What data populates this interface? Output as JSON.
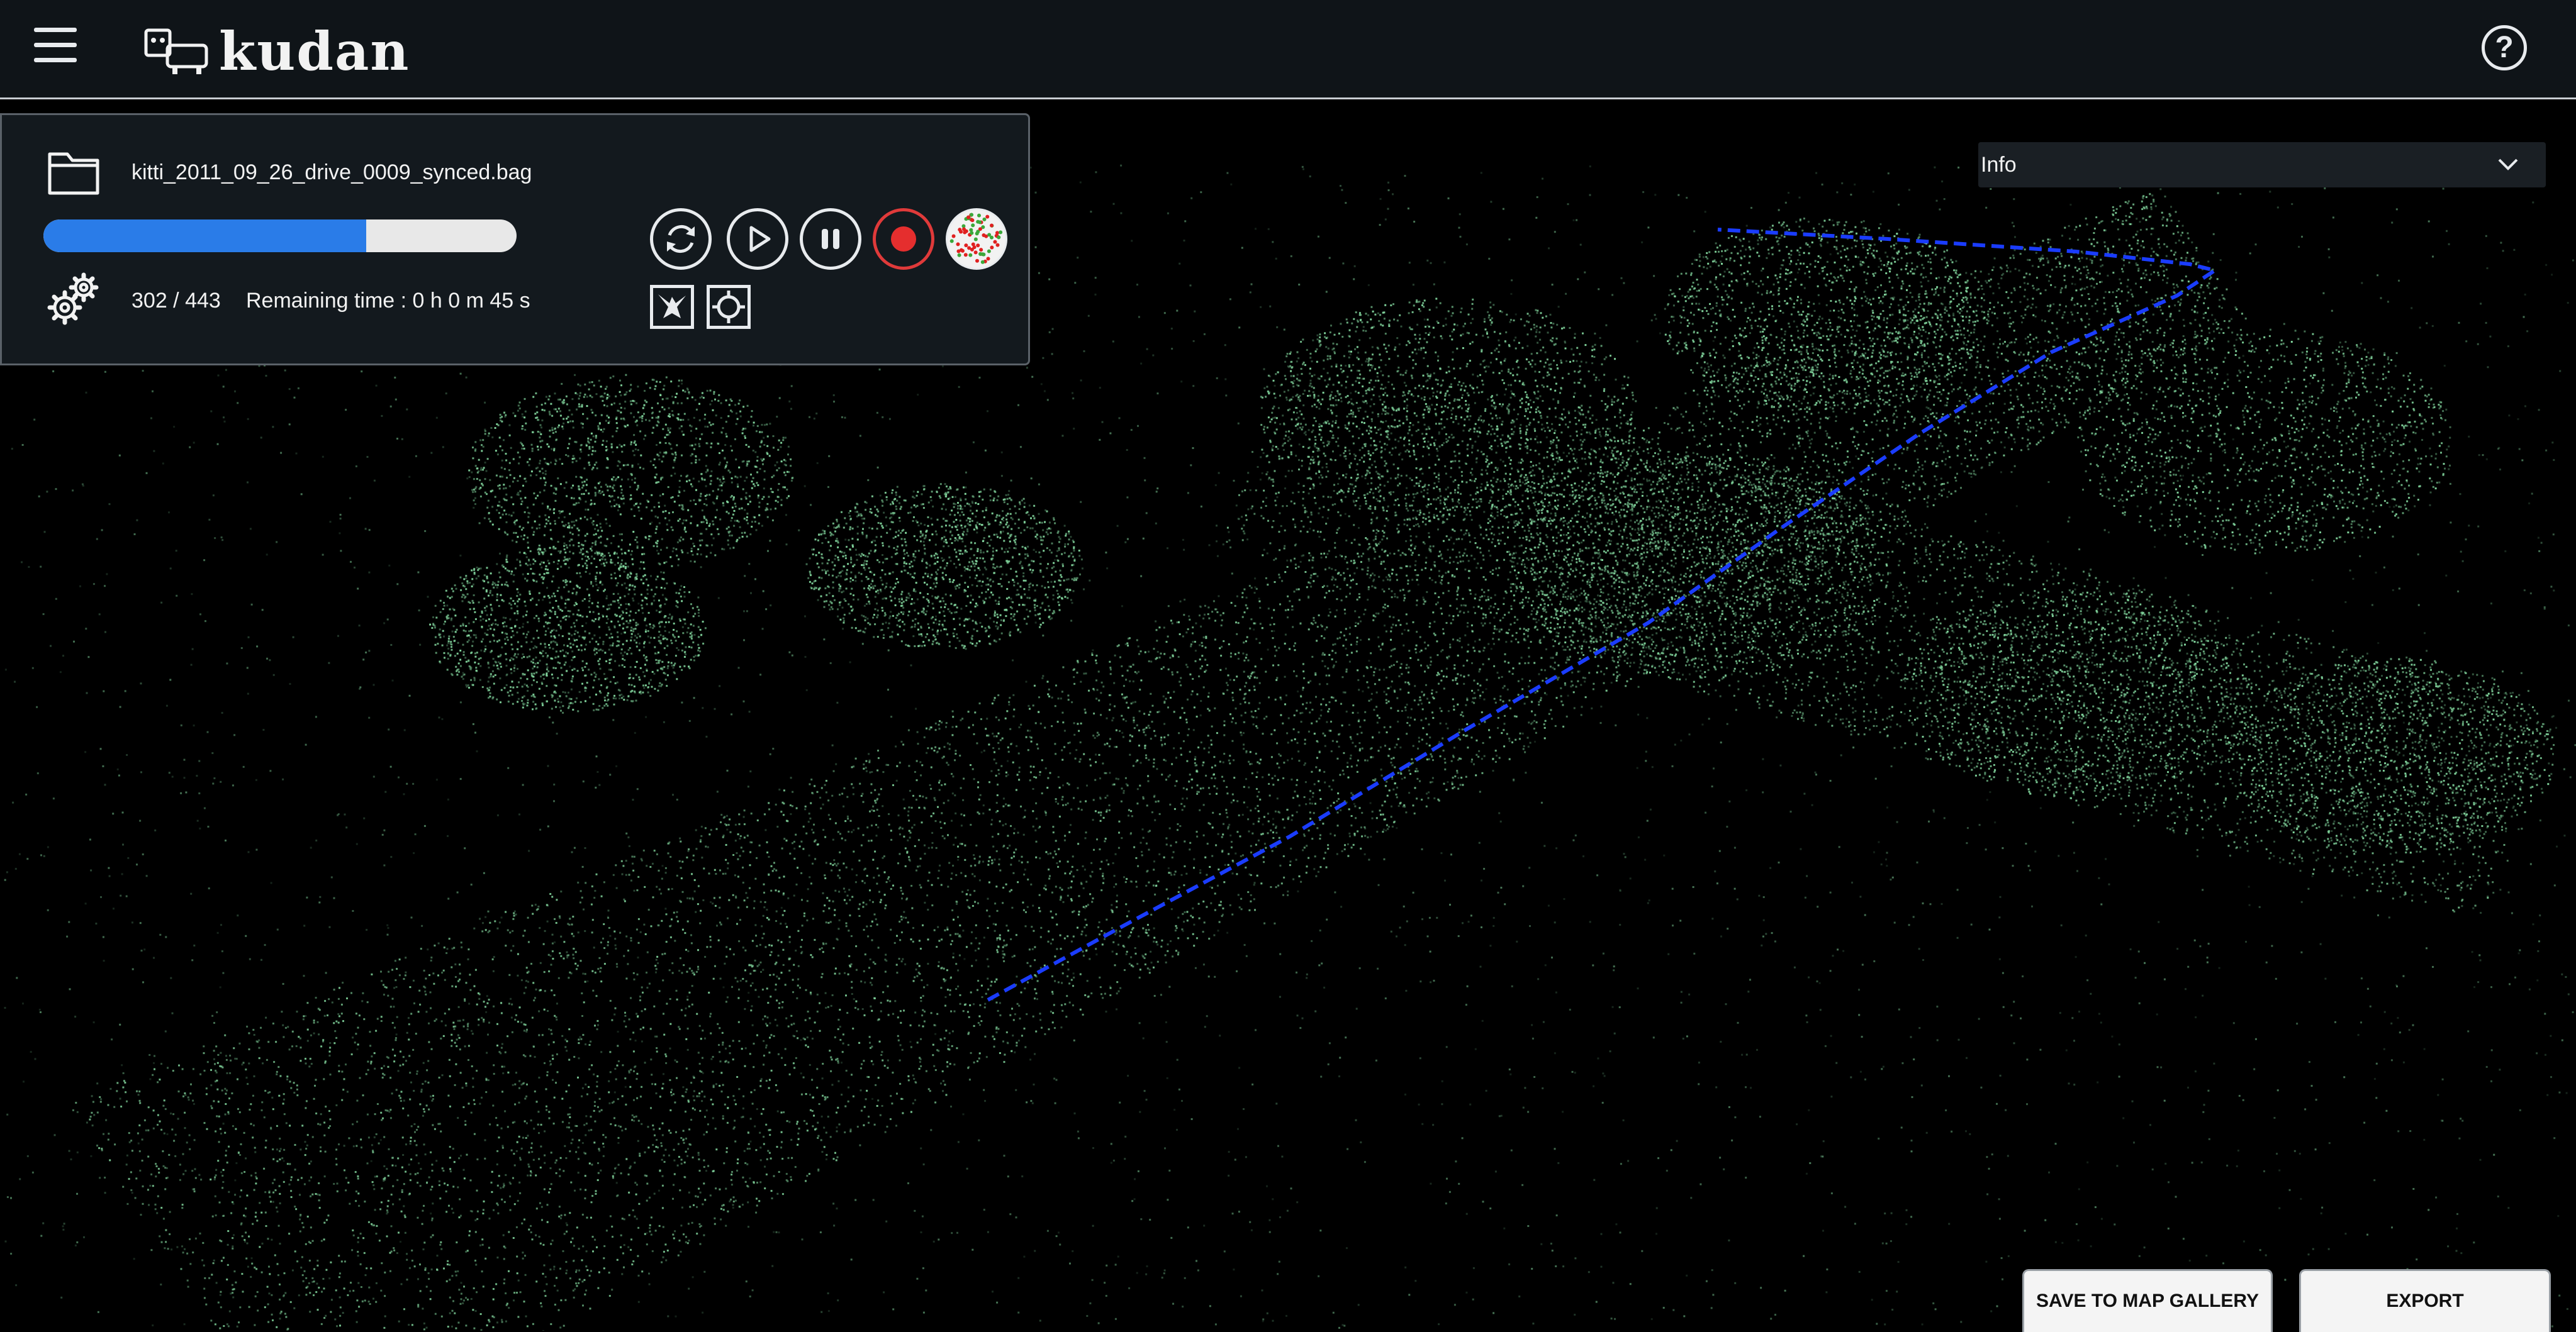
{
  "app": {
    "logo_text": "kudan",
    "menu_icon": "hamburger-menu-icon",
    "help_label": "?"
  },
  "player": {
    "file_name": "kitti_2011_09_26_drive_0009_synced.bag",
    "progress_fraction": 0.6817,
    "frame_count": "302 / 443",
    "remaining_time": "Remaining time : 0 h 0 m 45 s",
    "controls": [
      "reset-icon",
      "play-icon",
      "pause-icon",
      "record-icon",
      "point-cloud-icon",
      "bird-view-icon",
      "target-icon"
    ]
  },
  "info_dropdown": {
    "selected": "Info"
  },
  "actions": {
    "save_label": "SAVE TO MAP GALLERY",
    "export_label": "EXPORT"
  },
  "colors": {
    "topbar": "#0f1418",
    "panel": "#13191e",
    "progress": "#2a7ce8",
    "record": "#e52e2e",
    "points": "#7fd19a",
    "trajectory": "#1a3cff"
  }
}
